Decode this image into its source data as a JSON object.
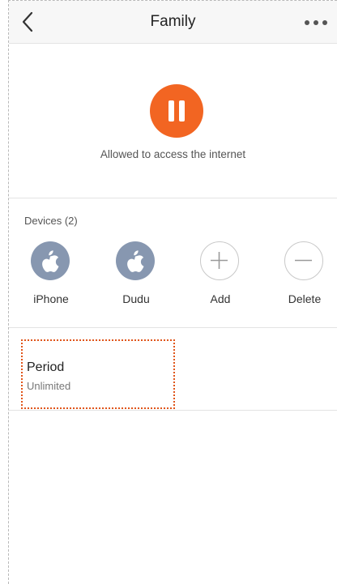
{
  "header": {
    "title": "Family",
    "back_icon": "chevron-left-icon",
    "more_icon": "more-horizontal-icon"
  },
  "status": {
    "text": "Allowed to access the internet",
    "button_icon": "pause-icon",
    "button_color": "#f26522"
  },
  "devices": {
    "header": "Devices (2)",
    "items": [
      {
        "label": "iPhone",
        "icon": "apple-icon"
      },
      {
        "label": "Dudu",
        "icon": "apple-icon"
      },
      {
        "label": "Add",
        "icon": "plus-icon"
      },
      {
        "label": "Delete",
        "icon": "minus-icon"
      }
    ]
  },
  "period": {
    "title": "Period",
    "value": "Unlimited"
  },
  "colors": {
    "accent": "#f26522",
    "device_icon_bg": "#8797b0",
    "highlight_border": "#e0551a"
  }
}
